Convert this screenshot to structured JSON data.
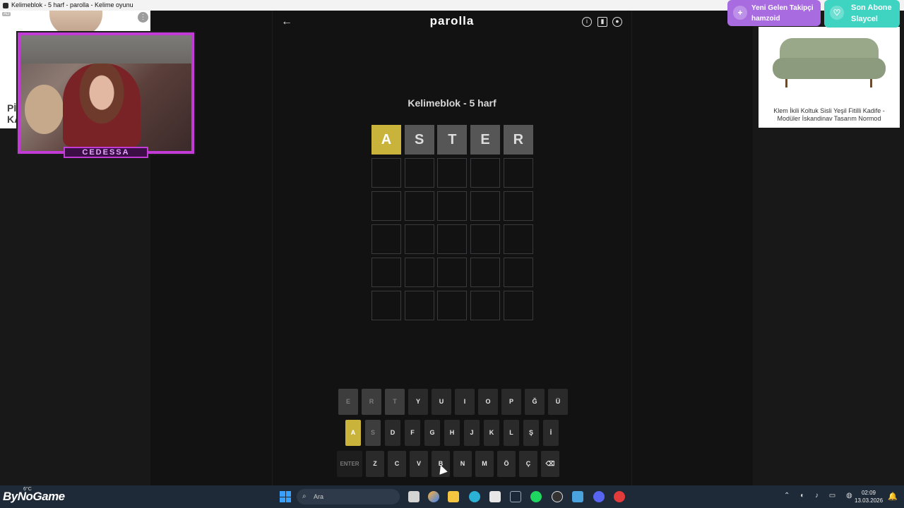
{
  "window": {
    "title": "Kelimeblok - 5 harf - parolla - Kelime oyunu"
  },
  "header": {
    "back_icon": "back-arrow-icon",
    "title": "parolla",
    "icons": [
      "info-icon",
      "stats-icon",
      "profile-icon"
    ]
  },
  "game": {
    "subtitle": "Kelimeblok - 5 harf",
    "rows": [
      [
        {
          "l": "A",
          "s": "present"
        },
        {
          "l": "S",
          "s": "absent"
        },
        {
          "l": "T",
          "s": "absent"
        },
        {
          "l": "E",
          "s": "absent"
        },
        {
          "l": "R",
          "s": "absent"
        }
      ],
      [
        {
          "l": "",
          "s": "empty"
        },
        {
          "l": "",
          "s": "empty"
        },
        {
          "l": "",
          "s": "empty"
        },
        {
          "l": "",
          "s": "empty"
        },
        {
          "l": "",
          "s": "empty"
        }
      ],
      [
        {
          "l": "",
          "s": "empty"
        },
        {
          "l": "",
          "s": "empty"
        },
        {
          "l": "",
          "s": "empty"
        },
        {
          "l": "",
          "s": "empty"
        },
        {
          "l": "",
          "s": "empty"
        }
      ],
      [
        {
          "l": "",
          "s": "empty"
        },
        {
          "l": "",
          "s": "empty"
        },
        {
          "l": "",
          "s": "empty"
        },
        {
          "l": "",
          "s": "empty"
        },
        {
          "l": "",
          "s": "empty"
        }
      ],
      [
        {
          "l": "",
          "s": "empty"
        },
        {
          "l": "",
          "s": "empty"
        },
        {
          "l": "",
          "s": "empty"
        },
        {
          "l": "",
          "s": "empty"
        },
        {
          "l": "",
          "s": "empty"
        }
      ],
      [
        {
          "l": "",
          "s": "empty"
        },
        {
          "l": "",
          "s": "empty"
        },
        {
          "l": "",
          "s": "empty"
        },
        {
          "l": "",
          "s": "empty"
        },
        {
          "l": "",
          "s": "empty"
        }
      ]
    ]
  },
  "keyboard": {
    "rows": [
      [
        {
          "k": "E",
          "s": "absent"
        },
        {
          "k": "R",
          "s": "absent"
        },
        {
          "k": "T",
          "s": "absent"
        },
        {
          "k": "Y",
          "s": "unused"
        },
        {
          "k": "U",
          "s": "unused"
        },
        {
          "k": "I",
          "s": "unused"
        },
        {
          "k": "O",
          "s": "unused"
        },
        {
          "k": "P",
          "s": "unused"
        },
        {
          "k": "Ğ",
          "s": "unused"
        },
        {
          "k": "Ü",
          "s": "unused"
        }
      ],
      [
        {
          "k": "A",
          "s": "present"
        },
        {
          "k": "S",
          "s": "absent"
        },
        {
          "k": "D",
          "s": "unused"
        },
        {
          "k": "F",
          "s": "unused"
        },
        {
          "k": "G",
          "s": "unused"
        },
        {
          "k": "H",
          "s": "unused"
        },
        {
          "k": "J",
          "s": "unused"
        },
        {
          "k": "K",
          "s": "unused"
        },
        {
          "k": "L",
          "s": "unused"
        },
        {
          "k": "Ş",
          "s": "unused"
        },
        {
          "k": "İ",
          "s": "unused"
        }
      ],
      [
        {
          "k": "ENTER",
          "s": "wide"
        },
        {
          "k": "Z",
          "s": "unused"
        },
        {
          "k": "C",
          "s": "unused"
        },
        {
          "k": "V",
          "s": "unused"
        },
        {
          "k": "B",
          "s": "unused"
        },
        {
          "k": "N",
          "s": "unused"
        },
        {
          "k": "M",
          "s": "unused"
        },
        {
          "k": "Ö",
          "s": "unused"
        },
        {
          "k": "Ç",
          "s": "unused"
        },
        {
          "k": "⌫",
          "s": "unused"
        }
      ]
    ]
  },
  "left_ad": {
    "badge": "AD",
    "text_line1": "Pİ",
    "text_line2": "KA",
    "menu": "⋮"
  },
  "webcam": {
    "label": "CEDESSA"
  },
  "right_ad": {
    "caption": "Klem İkili Koltuk Sisli Yeşil Fitilli Kadife - Modüler İskandinav Tasarım Normod"
  },
  "alerts": {
    "follower": {
      "title": "Yeni Gelen Takipçi",
      "name": "hamzoid",
      "icon": "user-plus-icon"
    },
    "subscriber": {
      "title": "Son Abone",
      "name": "Slaycel",
      "icon": "heart-icon"
    }
  },
  "taskbar": {
    "brand": "ByNoGame",
    "weather": "6°C",
    "search_placeholder": "Ara",
    "time": "02:09",
    "date": "13.03.2026",
    "apps": [
      "task-view-icon",
      "copilot-icon",
      "file-explorer-icon",
      "edge-icon",
      "store-icon",
      "steam-icon",
      "spotify-icon",
      "obs-icon",
      "photos-icon",
      "discord-icon",
      "app-icon"
    ]
  },
  "colors": {
    "present": "#c9b33b",
    "absent": "#565656",
    "background": "#121212",
    "webcam_border": "#c23bd6",
    "follower_alert": "#a96ce0",
    "sub_alert": "#3fd4c2"
  }
}
